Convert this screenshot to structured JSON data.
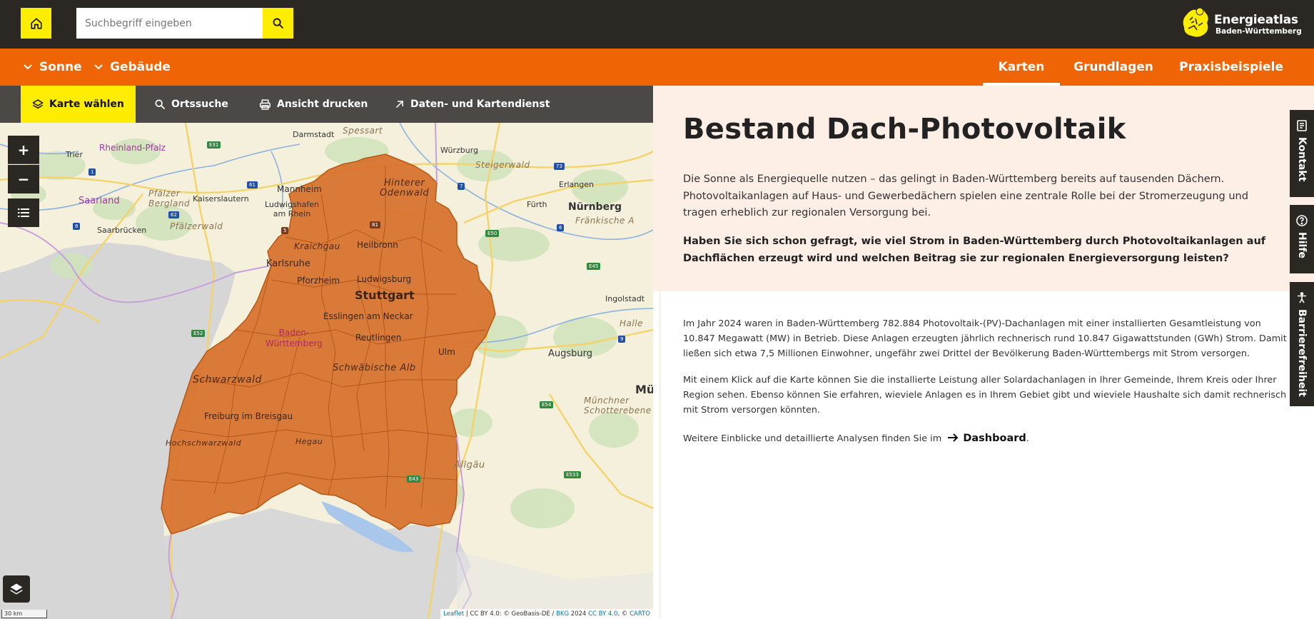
{
  "header": {
    "search_placeholder": "Suchbegriff eingeben",
    "logo_title": "Energieatlas",
    "logo_subtitle": "Baden-Württemberg",
    "accent_color": "#ffed00"
  },
  "nav": {
    "left": [
      {
        "label": "Sonne",
        "icon": "chevron-down-icon"
      },
      {
        "label": "Gebäude",
        "icon": "chevron-down-icon"
      }
    ],
    "tabs": [
      {
        "label": "Karten",
        "active": true
      },
      {
        "label": "Grundlagen",
        "active": false
      },
      {
        "label": "Praxisbeispiele",
        "active": false
      }
    ],
    "color": "#ef6506"
  },
  "map_toolbar": {
    "items": [
      {
        "label": "Karte wählen",
        "icon": "layers-icon",
        "active": true
      },
      {
        "label": "Ortssuche",
        "icon": "search-icon"
      },
      {
        "label": "Ansicht drucken",
        "icon": "printer-icon"
      },
      {
        "label": "Daten- und Kartendienst",
        "icon": "arrow-up-right-icon"
      }
    ]
  },
  "map": {
    "zoom_in": "+",
    "zoom_out": "−",
    "scale": "30 km",
    "attribution": {
      "leaflet": "Leaflet",
      "text1": " | CC BY 4.0: © GeoBasis-DE / ",
      "bkg": "BKG",
      "text2": " 2024 ",
      "ccby": "CC BY 4.0",
      "text3": ", © ",
      "carto": "CARTO"
    },
    "labels": {
      "rheinland_pfalz": "Rheinland-Pfalz",
      "trier": "Trier",
      "darmstadt": "Darmstadt",
      "spessart": "Spessart",
      "wuerzburg": "Würzburg",
      "steigerwald": "Steigerwald",
      "erlangen": "Erlangen",
      "fuerth": "Fürth",
      "nuernberg": "Nürnberg",
      "pfaelzer_bergland": "Pfälzer\nBergland",
      "kaiserslautern": "Kaiserslautern",
      "saarland": "Saarland",
      "saarbruecken": "Saarbrücken",
      "pfaelzerwald": "Pfälzerwald",
      "mannheim": "Mannheim",
      "ludwigshafen": "Ludwigshafen\nam Rhein",
      "hinterer_odenwald": "Hinterer\nOdenwald",
      "fraenkische": "Fränkische A",
      "kraichgau": "Kraichgau",
      "heilbronn": "Heilbronn",
      "karlsruhe": "Karlsruhe",
      "pforzheim": "Pforzheim",
      "ludwigsburg": "Ludwigsburg",
      "stuttgart": "Stuttgart",
      "ingolstadt": "Ingolstadt",
      "esslingen": "Esslingen am Neckar",
      "halle": "Halle",
      "baden_wuerttemberg": "Baden-\nWürttemberg",
      "reutlingen": "Reutlingen",
      "ulm": "Ulm",
      "augsburg": "Augsburg",
      "schwaebische_alb": "Schwäbische Alb",
      "schwarzwald": "Schwarzwald",
      "muenchen": "Mü",
      "muenchner": "Münchner\nSchotterebene",
      "freiburg": "Freiburg im Breisgau",
      "hochschwarzwald": "Hochschwarzwald",
      "hegau": "Hegau",
      "allgaeu": "Allgäu"
    },
    "road_shields": [
      "E31",
      "61",
      "1",
      "62",
      "8",
      "5",
      "81",
      "7",
      "E50",
      "6",
      "73",
      "E45",
      "9",
      "E43",
      "E54",
      "E533",
      "E52"
    ],
    "fill_color": "#d9722d"
  },
  "content": {
    "title": "Bestand Dach-Photovoltaik",
    "intro": "Die Sonne als Energiequelle nutzen – das gelingt in Baden-Württemberg bereits auf tausenden Dächern. Photovoltaikanlagen auf Haus- und Gewerbedächern spielen eine zentrale Rolle bei der Stromerzeugung und tragen erheblich zur regionalen Versorgung bei.",
    "question": "Haben Sie sich schon gefragt, wie viel Strom in Baden-Württemberg durch Photovoltaikanlagen auf Dachflächen erzeugt wird und welchen Beitrag sie zur regionalen Energieversorgung leisten?",
    "fact": "Im Jahr 2024 waren in Baden-Württemberg 782.884 Photovoltaik-(PV)-Dachanlagen mit einer installierten Gesamtleistung von 10.847 Megawatt (MW) in Betrieb. Diese Anlagen erzeugten jährlich rechnerisch rund 10.847 Gigawattstunden (GWh) Strom. Damit ließen sich etwa 7,5 Millionen Einwohner, ungefähr zwei Drittel der Bevölkerung Baden-Württembergs mit Strom versorgen.",
    "click_info": "Mit einem Klick auf die Karte können Sie die installierte Leistung aller Solardachanlagen in Ihrer Gemeinde, Ihrem Kreis oder Ihrer Region sehen. Ebenso können Sie erfahren, wieviele Anlagen es in Ihrem Gebiet gibt und wieviele Haushalte sich damit rechnerisch mit Strom versorgen könnten.",
    "more_prefix": "Weitere Einblicke und detaillierte Analysen finden Sie im",
    "dashboard_link": "Dashboard",
    "more_suffix": "."
  },
  "side_tabs": [
    {
      "label": "Kontakt",
      "icon": "document-icon"
    },
    {
      "label": "Hilfe",
      "icon": "question-icon"
    },
    {
      "label": "Barrierefreiheit",
      "icon": "accessibility-icon"
    }
  ]
}
